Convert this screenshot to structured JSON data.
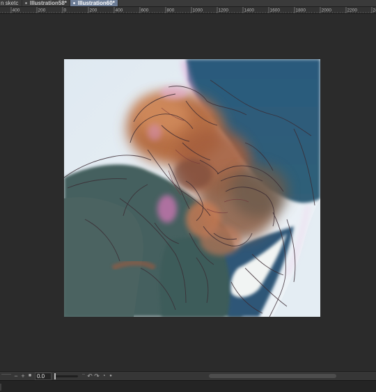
{
  "tabs": [
    {
      "label": "n sketc",
      "active": false
    },
    {
      "label": "Illustration58*",
      "active": false
    },
    {
      "label": "Illustration60*",
      "active": true
    }
  ],
  "ruler": {
    "labels": [
      "400",
      "200",
      "0",
      "200",
      "400",
      "600",
      "800",
      "1000",
      "1200",
      "1400",
      "1600",
      "1800",
      "2000",
      "2200",
      "24"
    ]
  },
  "toolbar": {
    "zoom_out_icon": "minus-icon",
    "zoom_in_icon": "plus-icon",
    "fit_icon": "square-icon",
    "zoom_value": "0.0",
    "undo_icon": "undo-icon",
    "redo_icon": "redo-icon",
    "rotate_icon": "rotate-icon"
  },
  "colors": {
    "workspace": "#2b2b2b",
    "tab_active": "#6d7d96",
    "artwork_blue": "#2f5a78",
    "artwork_sky": "#e3ecf3",
    "artwork_teal": "#3f6060",
    "artwork_rust": "#b06a42"
  }
}
